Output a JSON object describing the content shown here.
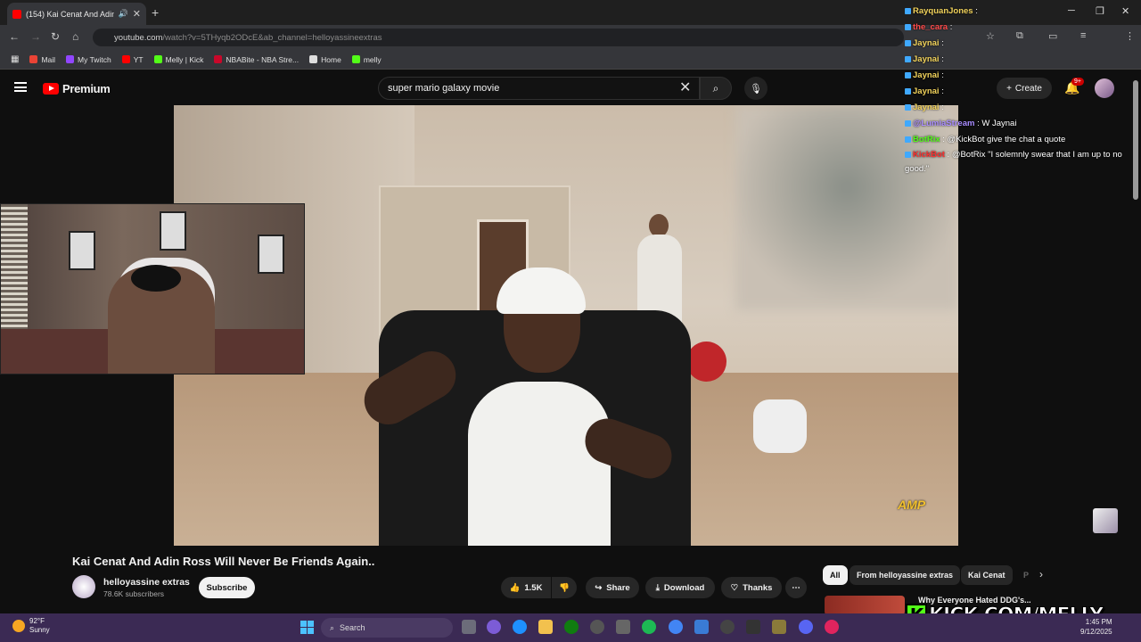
{
  "browser": {
    "tab_title": "(154) Kai Cenat And Adin R",
    "url_main": "youtube.com",
    "url_rest": "/watch?v=5THyqb2ODcE&ab_channel=helloyassineextras",
    "bookmarks": [
      "Mail",
      "My Twitch",
      "YT",
      "Melly | Kick",
      "NBABite - NBA Stre...",
      "Home",
      "melly"
    ]
  },
  "youtube": {
    "logo_text": "Premium",
    "search_value": "super mario galaxy movie",
    "create_label": "Create",
    "notif_badge": "9+",
    "video_title": "Kai Cenat And Adin Ross Will Never Be Friends Again..",
    "channel_name": "helloyassine extras",
    "subscribers": "78.6K subscribers",
    "subscribe_label": "Subscribe",
    "likes": "1.5K",
    "share_label": "Share",
    "download_label": "Download",
    "thanks_label": "Thanks",
    "chips": [
      "All",
      "From helloyassine extras",
      "Kai Cenat",
      "P"
    ],
    "related_title": "Why Everyone Hated DDG's..."
  },
  "chat": [
    {
      "user": "RayquanJones",
      "text": "",
      "color": "#f1d25b"
    },
    {
      "user": "the_cara",
      "text": "",
      "color": "#ff4a4a"
    },
    {
      "user": "Jaynai",
      "text": "",
      "color": "#f1d25b"
    },
    {
      "user": "Jaynai",
      "text": "",
      "color": "#f1d25b"
    },
    {
      "user": "Jaynai",
      "text": "",
      "color": "#f1d25b"
    },
    {
      "user": "Jaynai",
      "text": "",
      "color": "#f1d25b"
    },
    {
      "user": "Jaynai",
      "text": "",
      "color": "#f1d25b"
    },
    {
      "user": "@LumiaStream",
      "text": "W Jaynai",
      "color": "#a98cff"
    },
    {
      "user": "BotRix",
      "text": "@KickBot give the chat a quote",
      "color": "#53fc18"
    },
    {
      "user": "KickBot",
      "text": "@BotRix \"I solemnly swear that I am up to no good.\"",
      "color": "#ff3030"
    }
  ],
  "overlay": {
    "kick_url": "KICK.COM/MELLY",
    "watermark": "AMP"
  },
  "taskbar": {
    "temp": "92°F",
    "condition": "Sunny",
    "search_label": "Search",
    "time": "1:45 PM",
    "date": "9/12/2025"
  }
}
